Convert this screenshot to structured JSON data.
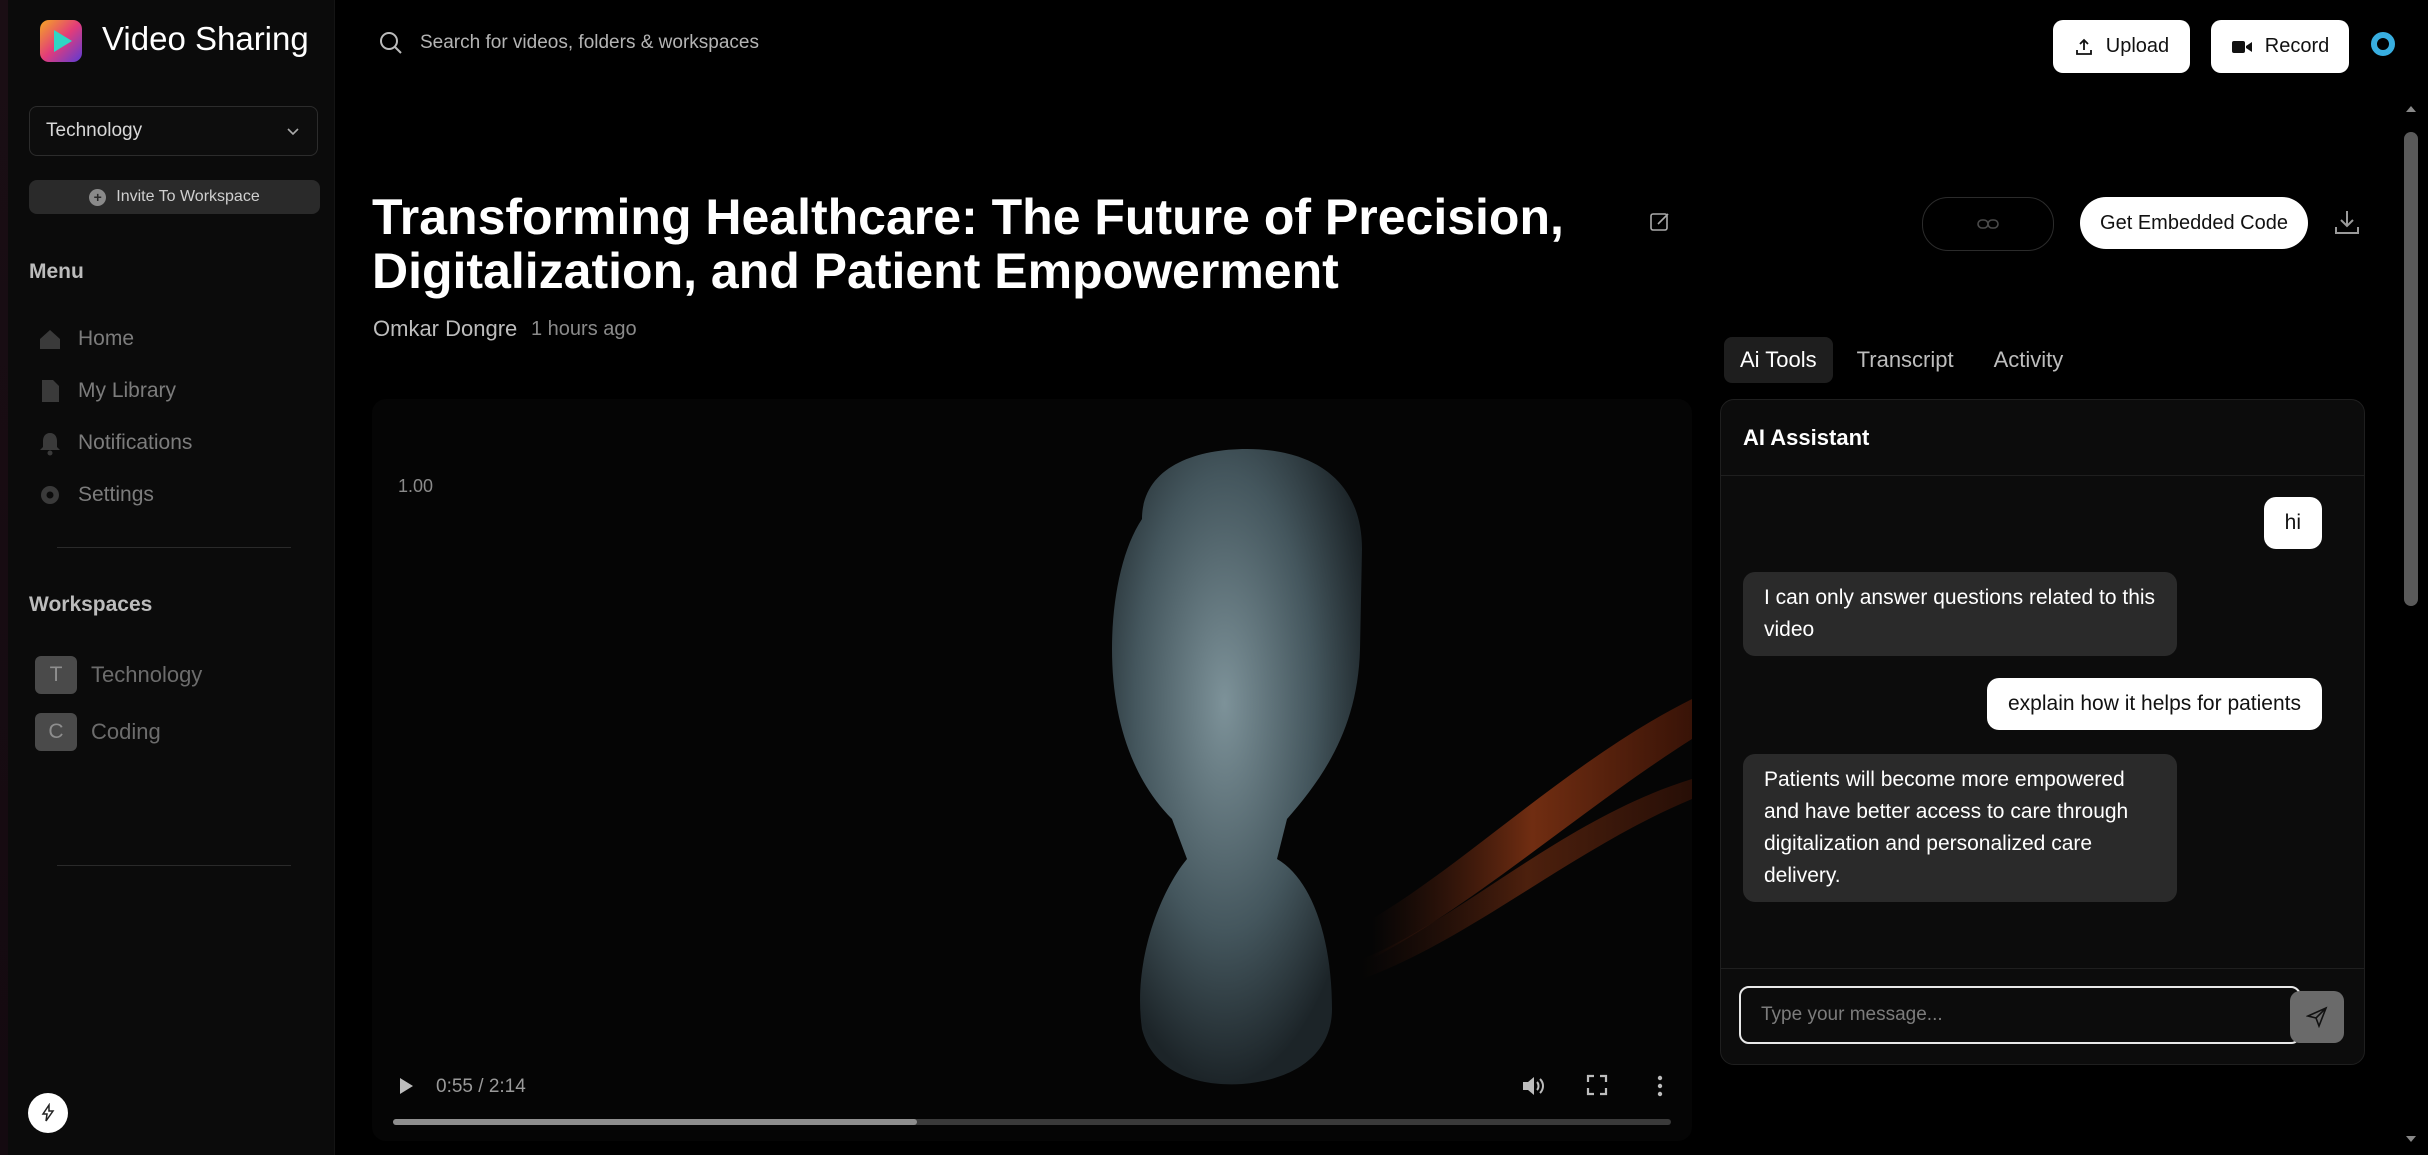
{
  "app": {
    "title": "Video Sharing"
  },
  "header": {
    "search_placeholder": "Search for videos, folders & workspaces",
    "upload_label": "Upload",
    "record_label": "Record"
  },
  "sidebar": {
    "workspace_selected": "Technology",
    "invite_label": "Invite To Workspace",
    "menu_heading": "Menu",
    "menu_items": [
      {
        "label": "Home",
        "icon": "home-icon"
      },
      {
        "label": "My Library",
        "icon": "file-icon"
      },
      {
        "label": "Notifications",
        "icon": "bell-icon"
      },
      {
        "label": "Settings",
        "icon": "gear-icon"
      }
    ],
    "workspaces_heading": "Workspaces",
    "workspaces": [
      {
        "initial": "T",
        "name": "Technology"
      },
      {
        "initial": "C",
        "name": "Coding"
      }
    ]
  },
  "video": {
    "title": "Transforming Healthcare: The Future of Precision, Digitalization, and Patient Empowerment",
    "author": "Omkar Dongre",
    "posted": "1 hours ago",
    "speed": "1.00",
    "time": "0:55 / 2:14",
    "progress": 0.41
  },
  "actions": {
    "embed_label": "Get Embedded Code"
  },
  "tabs": [
    {
      "label": "Ai Tools",
      "active": true
    },
    {
      "label": "Transcript",
      "active": false
    },
    {
      "label": "Activity",
      "active": false
    }
  ],
  "ai_panel": {
    "heading": "AI Assistant",
    "messages": [
      {
        "role": "user",
        "text": "hi"
      },
      {
        "role": "bot",
        "text": "I can only answer questions related to this video"
      },
      {
        "role": "user",
        "text": "explain how it helps for patients"
      },
      {
        "role": "bot",
        "text": "Patients will become more empowered and have better access to care through digitalization and personalized care delivery."
      }
    ],
    "input_placeholder": "Type your message..."
  },
  "colors": {
    "accent_ring": "#38aee0",
    "background": "#000000",
    "panel": "#0c0c0c"
  }
}
